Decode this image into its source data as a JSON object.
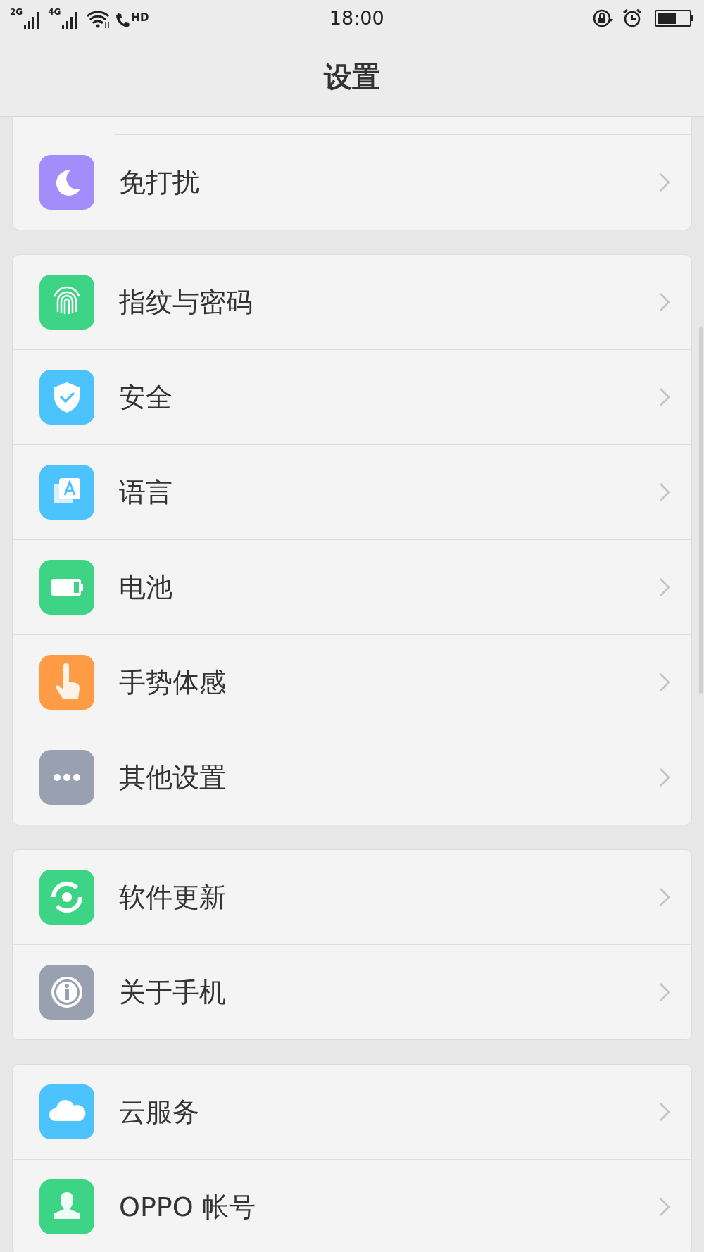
{
  "status_bar": {
    "sim_1": "2G",
    "sim_2": "4G",
    "call": "HD",
    "time": "18:00"
  },
  "header": {
    "title": "设置"
  },
  "groups": [
    {
      "items": [
        {
          "label": "免打扰",
          "kind": "moon",
          "color": "#a38dfb"
        }
      ]
    },
    {
      "items": [
        {
          "label": "指纹与密码",
          "kind": "fingerprint",
          "color": "#3ed485"
        },
        {
          "label": "安全",
          "kind": "shield",
          "color": "#4cc3fd"
        },
        {
          "label": "语言",
          "kind": "language",
          "color": "#4cc3fd"
        },
        {
          "label": "电池",
          "kind": "battery",
          "color": "#3ed485"
        },
        {
          "label": "手势体感",
          "kind": "hand",
          "color": "#ff9a45"
        },
        {
          "label": "其他设置",
          "kind": "dots",
          "color": "#99a1b0"
        }
      ]
    },
    {
      "items": [
        {
          "label": "软件更新",
          "kind": "update",
          "color": "#3ed485"
        },
        {
          "label": "关于手机",
          "kind": "info",
          "color": "#99a1b0"
        }
      ]
    },
    {
      "items": [
        {
          "label": "云服务",
          "kind": "cloud",
          "color": "#4cc3fd"
        },
        {
          "label": "OPPO 帐号",
          "kind": "person",
          "color": "#3ed485"
        }
      ]
    }
  ]
}
